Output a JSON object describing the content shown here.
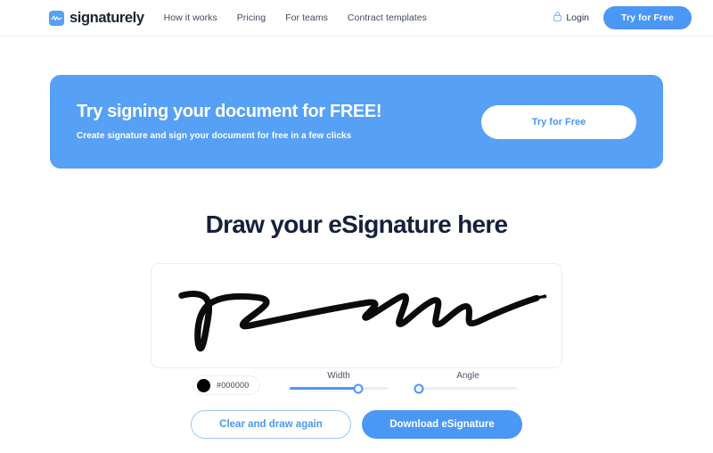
{
  "header": {
    "brand": {
      "name": "signaturely",
      "icon": "signature-logo-icon"
    },
    "nav": [
      {
        "label": "How it works"
      },
      {
        "label": "Pricing"
      },
      {
        "label": "For teams"
      },
      {
        "label": "Contract templates"
      }
    ],
    "login": {
      "label": "Login",
      "icon": "lock-icon"
    },
    "cta": {
      "label": "Try for Free"
    }
  },
  "banner": {
    "title": "Try signing your document for FREE!",
    "subtitle": "Create signature and sign your document for free in a few clicks",
    "cta": {
      "label": "Try for Free"
    },
    "background_color": "#56a0f5"
  },
  "main": {
    "title": "Draw your eSignature here",
    "canvas": {
      "name": "signature-canvas",
      "stroke_color": "#000000"
    },
    "color": {
      "label": "#000000",
      "value": "#000000"
    },
    "sliders": [
      {
        "label": "Width",
        "percent": 70
      },
      {
        "label": "Angle",
        "percent": 0
      }
    ],
    "actions": {
      "clear": {
        "label": "Clear and draw again"
      },
      "download": {
        "label": "Download eSignature"
      }
    }
  },
  "colors": {
    "accent": "#4a97f6",
    "banner": "#56a0f5",
    "heading": "#16203a",
    "border": "#eceef1"
  }
}
